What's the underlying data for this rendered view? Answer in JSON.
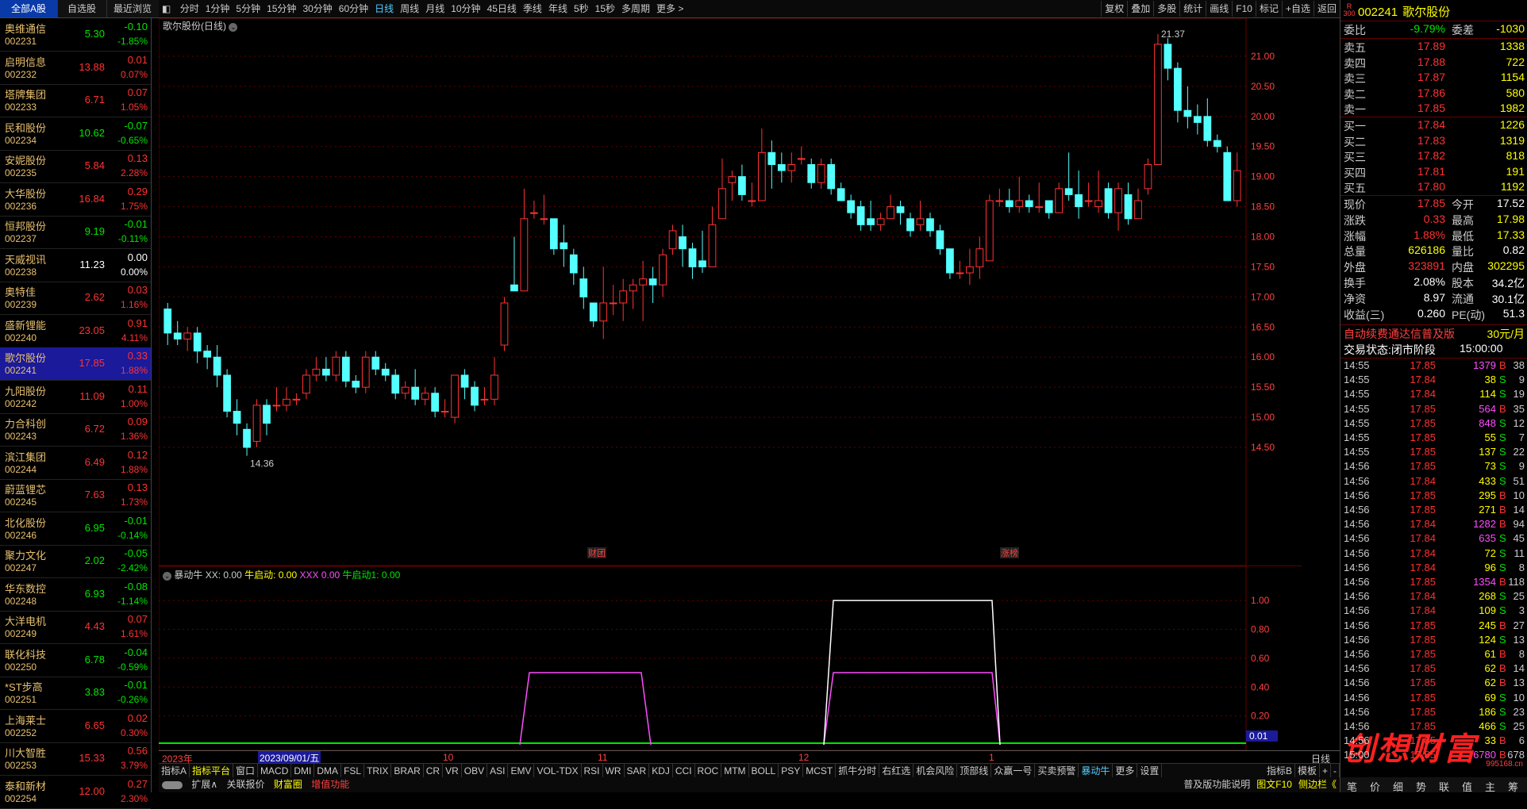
{
  "left_tabs": [
    "全部A股",
    "自选股",
    "最近浏览"
  ],
  "period_tabs": [
    "分时",
    "1分钟",
    "5分钟",
    "15分钟",
    "30分钟",
    "60分钟",
    "日线",
    "周线",
    "月线",
    "10分钟",
    "45日线",
    "季线",
    "年线",
    "5秒",
    "15秒",
    "多周期",
    "更多 >"
  ],
  "active_period": "日线",
  "tools": [
    "复权",
    "叠加",
    "多股",
    "统计",
    "画线",
    "F10",
    "标记",
    "+自选",
    "返回"
  ],
  "stocks": [
    {
      "name": "奥维通信",
      "code": "002231",
      "price": "5.30",
      "chg": "-0.10",
      "pct": "-1.85%",
      "dir": "dn"
    },
    {
      "name": "启明信息",
      "code": "002232",
      "price": "13.88",
      "chg": "0.01",
      "pct": "0.07%",
      "dir": "up"
    },
    {
      "name": "塔牌集团",
      "code": "002233",
      "price": "6.71",
      "chg": "0.07",
      "pct": "1.05%",
      "dir": "up"
    },
    {
      "name": "民和股份",
      "code": "002234",
      "price": "10.62",
      "chg": "-0.07",
      "pct": "-0.65%",
      "dir": "dn"
    },
    {
      "name": "安妮股份",
      "code": "002235",
      "price": "5.84",
      "chg": "0.13",
      "pct": "2.28%",
      "dir": "up"
    },
    {
      "name": "大华股份",
      "code": "002236",
      "price": "16.84",
      "chg": "0.29",
      "pct": "1.75%",
      "dir": "up"
    },
    {
      "name": "恒邦股份",
      "code": "002237",
      "price": "9.19",
      "chg": "-0.01",
      "pct": "-0.11%",
      "dir": "dn"
    },
    {
      "name": "天威视讯",
      "code": "002238",
      "price": "11.23",
      "chg": "0.00",
      "pct": "0.00%",
      "dir": "wh"
    },
    {
      "name": "奥特佳",
      "code": "002239",
      "price": "2.62",
      "chg": "0.03",
      "pct": "1.16%",
      "dir": "up"
    },
    {
      "name": "盛新锂能",
      "code": "002240",
      "price": "23.05",
      "chg": "0.91",
      "pct": "4.11%",
      "dir": "up"
    },
    {
      "name": "歌尔股份",
      "code": "002241",
      "price": "17.85",
      "chg": "0.33",
      "pct": "1.88%",
      "dir": "up"
    },
    {
      "name": "九阳股份",
      "code": "002242",
      "price": "11.09",
      "chg": "0.11",
      "pct": "1.00%",
      "dir": "up"
    },
    {
      "name": "力合科创",
      "code": "002243",
      "price": "6.72",
      "chg": "0.09",
      "pct": "1.36%",
      "dir": "up"
    },
    {
      "name": "滨江集团",
      "code": "002244",
      "price": "6.49",
      "chg": "0.12",
      "pct": "1.88%",
      "dir": "up"
    },
    {
      "name": "蔚蓝锂芯",
      "code": "002245",
      "price": "7.63",
      "chg": "0.13",
      "pct": "1.73%",
      "dir": "up"
    },
    {
      "name": "北化股份",
      "code": "002246",
      "price": "6.95",
      "chg": "-0.01",
      "pct": "-0.14%",
      "dir": "dn"
    },
    {
      "name": "聚力文化",
      "code": "002247",
      "price": "2.02",
      "chg": "-0.05",
      "pct": "-2.42%",
      "dir": "dn"
    },
    {
      "name": "华东数控",
      "code": "002248",
      "price": "6.93",
      "chg": "-0.08",
      "pct": "-1.14%",
      "dir": "dn"
    },
    {
      "name": "大洋电机",
      "code": "002249",
      "price": "4.43",
      "chg": "0.07",
      "pct": "1.61%",
      "dir": "up"
    },
    {
      "name": "联化科技",
      "code": "002250",
      "price": "6.78",
      "chg": "-0.04",
      "pct": "-0.59%",
      "dir": "dn"
    },
    {
      "name": "*ST步高",
      "code": "002251",
      "price": "3.83",
      "chg": "-0.01",
      "pct": "-0.26%",
      "dir": "dn"
    },
    {
      "name": "上海莱士",
      "code": "002252",
      "price": "6.65",
      "chg": "0.02",
      "pct": "0.30%",
      "dir": "up"
    },
    {
      "name": "川大智胜",
      "code": "002253",
      "price": "15.33",
      "chg": "0.56",
      "pct": "3.79%",
      "dir": "up"
    },
    {
      "name": "泰和新材",
      "code": "002254",
      "price": "12.00",
      "chg": "0.27",
      "pct": "2.30%",
      "dir": "up"
    }
  ],
  "selected_code": "002241",
  "chart": {
    "title": "歌尔股份(日线)",
    "high_label": "21.37",
    "low_label": "14.36",
    "price_ticks": [
      "21.00",
      "20.50",
      "20.00",
      "19.50",
      "19.00",
      "18.50",
      "18.00",
      "17.50",
      "17.00",
      "16.50",
      "16.00",
      "15.50",
      "15.00",
      "14.50"
    ],
    "markers": [
      "财团",
      "涨榜"
    ],
    "candles": [
      [
        16.8,
        16.4,
        16.9,
        16.2
      ],
      [
        16.4,
        16.3,
        16.6,
        16.2
      ],
      [
        16.3,
        16.4,
        16.5,
        16.1
      ],
      [
        16.4,
        16.1,
        16.5,
        15.9
      ],
      [
        16.1,
        16.0,
        16.2,
        15.8
      ],
      [
        16.0,
        15.7,
        16.2,
        15.5
      ],
      [
        15.7,
        15.1,
        15.8,
        15.0
      ],
      [
        15.1,
        14.9,
        15.3,
        14.7
      ],
      [
        14.8,
        14.5,
        14.9,
        14.36
      ],
      [
        14.6,
        15.2,
        15.3,
        14.5
      ],
      [
        15.2,
        14.9,
        15.3,
        14.7
      ],
      [
        15.2,
        15.2,
        15.5,
        15.1
      ],
      [
        15.2,
        15.3,
        15.5,
        15.1
      ],
      [
        15.3,
        15.3,
        15.4,
        15.2
      ],
      [
        15.4,
        15.7,
        15.8,
        15.3
      ],
      [
        15.7,
        15.8,
        16.0,
        15.6
      ],
      [
        15.8,
        15.7,
        16.0,
        15.6
      ],
      [
        15.7,
        16.0,
        16.1,
        15.6
      ],
      [
        16.0,
        15.6,
        16.1,
        15.5
      ],
      [
        15.6,
        15.5,
        15.7,
        15.4
      ],
      [
        15.5,
        16.0,
        16.1,
        15.4
      ],
      [
        16.0,
        15.8,
        16.1,
        15.7
      ],
      [
        15.8,
        15.7,
        15.9,
        15.6
      ],
      [
        15.7,
        15.4,
        15.8,
        15.3
      ],
      [
        15.4,
        15.5,
        15.6,
        15.3
      ],
      [
        15.5,
        15.3,
        15.8,
        15.2
      ],
      [
        15.3,
        15.4,
        15.5,
        15.2
      ],
      [
        15.4,
        15.1,
        15.5,
        15.0
      ],
      [
        15.1,
        15.1,
        15.3,
        15.0
      ],
      [
        15.0,
        15.7,
        15.7,
        14.9
      ],
      [
        15.7,
        15.5,
        15.8,
        15.3
      ],
      [
        15.5,
        15.2,
        15.6,
        15.1
      ],
      [
        15.3,
        15.3,
        15.5,
        15.2
      ],
      [
        15.3,
        15.7,
        16.0,
        15.2
      ],
      [
        16.2,
        16.9,
        17.0,
        16.1
      ],
      [
        17.2,
        17.1,
        18.0,
        17.1
      ],
      [
        17.1,
        18.3,
        18.8,
        17.1
      ],
      [
        18.4,
        18.4,
        18.6,
        18.3
      ],
      [
        18.3,
        18.3,
        18.7,
        18.2
      ],
      [
        18.3,
        17.8,
        18.3,
        17.7
      ],
      [
        17.9,
        17.8,
        18.2,
        17.5
      ],
      [
        17.7,
        17.4,
        17.8,
        17.2
      ],
      [
        17.3,
        17.0,
        17.5,
        16.8
      ],
      [
        16.9,
        16.6,
        16.9,
        16.5
      ],
      [
        16.6,
        16.9,
        17.5,
        16.3
      ],
      [
        16.9,
        16.9,
        17.2,
        16.7
      ],
      [
        16.9,
        17.1,
        17.3,
        16.6
      ],
      [
        17.1,
        17.2,
        17.3,
        16.8
      ],
      [
        17.2,
        17.3,
        17.6,
        16.6
      ],
      [
        17.3,
        17.2,
        17.5,
        16.9
      ],
      [
        17.2,
        17.7,
        17.8,
        17.0
      ],
      [
        17.8,
        18.1,
        18.2,
        17.7
      ],
      [
        18.0,
        17.8,
        18.2,
        17.5
      ],
      [
        17.8,
        17.5,
        17.9,
        17.3
      ],
      [
        17.6,
        17.5,
        18.1,
        17.4
      ],
      [
        17.5,
        18.2,
        18.5,
        17.5
      ],
      [
        18.3,
        18.8,
        19.3,
        18.3
      ],
      [
        18.9,
        19.0,
        19.1,
        18.6
      ],
      [
        19.0,
        18.7,
        19.2,
        18.6
      ],
      [
        18.6,
        18.6,
        18.9,
        18.5
      ],
      [
        18.6,
        19.4,
        19.8,
        18.6
      ],
      [
        19.4,
        19.2,
        19.6,
        18.8
      ],
      [
        19.2,
        19.1,
        19.4,
        18.9
      ],
      [
        19.1,
        19.2,
        19.4,
        18.9
      ],
      [
        19.3,
        19.3,
        19.5,
        19.2
      ],
      [
        19.2,
        18.9,
        19.3,
        18.8
      ],
      [
        18.9,
        19.2,
        19.3,
        18.8
      ],
      [
        19.2,
        18.8,
        19.3,
        18.7
      ],
      [
        18.8,
        18.6,
        18.9,
        18.6
      ],
      [
        18.6,
        18.4,
        18.7,
        18.3
      ],
      [
        18.5,
        18.2,
        18.6,
        18.1
      ],
      [
        18.3,
        18.2,
        18.6,
        18.1
      ],
      [
        18.2,
        18.3,
        18.4,
        18.1
      ],
      [
        18.3,
        18.5,
        18.7,
        18.3
      ],
      [
        18.5,
        18.4,
        18.6,
        18.2
      ],
      [
        18.3,
        18.1,
        18.4,
        18.0
      ],
      [
        18.2,
        18.3,
        18.6,
        18.1
      ],
      [
        18.3,
        18.1,
        18.4,
        18.0
      ],
      [
        18.1,
        17.8,
        18.2,
        17.7
      ],
      [
        17.8,
        17.4,
        17.8,
        17.3
      ],
      [
        17.4,
        17.4,
        17.6,
        17.3
      ],
      [
        17.4,
        17.5,
        17.8,
        17.2
      ],
      [
        17.5,
        17.8,
        18.0,
        17.3
      ],
      [
        17.6,
        18.6,
        18.7,
        17.6
      ],
      [
        18.6,
        18.6,
        18.8,
        18.5
      ],
      [
        18.6,
        18.5,
        18.8,
        18.4
      ],
      [
        18.5,
        18.6,
        19.0,
        18.4
      ],
      [
        18.6,
        18.5,
        18.7,
        18.4
      ],
      [
        18.5,
        18.5,
        18.9,
        18.4
      ],
      [
        18.6,
        18.4,
        18.6,
        18.3
      ],
      [
        18.4,
        18.8,
        18.9,
        18.4
      ],
      [
        18.8,
        18.7,
        19.4,
        18.6
      ],
      [
        18.7,
        18.5,
        19.1,
        18.3
      ],
      [
        18.6,
        18.6,
        18.9,
        18.5
      ],
      [
        18.5,
        18.6,
        19.1,
        18.4
      ],
      [
        18.8,
        18.4,
        18.9,
        18.3
      ],
      [
        18.4,
        18.8,
        18.9,
        18.1
      ],
      [
        18.7,
        18.3,
        18.9,
        18.2
      ],
      [
        18.3,
        18.6,
        18.8,
        18.3
      ],
      [
        18.8,
        19.2,
        19.3,
        18.7
      ],
      [
        19.2,
        21.2,
        21.37,
        19.2
      ],
      [
        21.2,
        20.8,
        21.3,
        20.6
      ],
      [
        20.8,
        20.1,
        20.9,
        19.9
      ],
      [
        20.1,
        20.0,
        20.5,
        19.8
      ],
      [
        20.0,
        19.9,
        20.2,
        19.7
      ],
      [
        20.0,
        19.6,
        20.3,
        19.5
      ],
      [
        19.6,
        19.5,
        19.7,
        19.4
      ],
      [
        19.4,
        18.6,
        19.5,
        18.6
      ],
      [
        18.6,
        19.1,
        19.4,
        18.5
      ]
    ]
  },
  "indicator": {
    "name": "暴动牛",
    "xx_label": "XX:",
    "xx_value": "0.00",
    "nqd_label": "牛启动:",
    "nqd_value": "0.00",
    "xxx_label": "XXX",
    "xxx_value": "0.00",
    "nqd1_label": "牛启动1:",
    "nqd1_value": "0.00",
    "ticks": [
      "1.00",
      "0.80",
      "0.60",
      "0.40",
      "0.20"
    ],
    "current_value": "0.01"
  },
  "date_axis": {
    "start": "2023年",
    "crosshair": "2023/09/01/五",
    "months": [
      "9",
      "10",
      "11",
      "12",
      "1"
    ],
    "right_label": "日线"
  },
  "indicator_tabs": [
    "指标A",
    "指标平台",
    "窗口",
    "MACD",
    "DMI",
    "DMA",
    "FSL",
    "TRIX",
    "BRAR",
    "CR",
    "VR",
    "OBV",
    "ASI",
    "EMV",
    "VOL-TDX",
    "RSI",
    "WR",
    "SAR",
    "KDJ",
    "CCI",
    "ROC",
    "MTM",
    "BOLL",
    "PSY",
    "MCST",
    "抓牛分时",
    "右红选",
    "机会风险",
    "顶部线",
    "众赢一号",
    "买卖预警",
    "暴动牛",
    "更多",
    "设置"
  ],
  "indicator_tabs_right": [
    "指标B",
    "模板"
  ],
  "bottom_tabs": [
    "扩展∧",
    "关联报价",
    "财富圈",
    "增值功能"
  ],
  "bottom_right": [
    "普及版功能说明",
    "图文F10",
    "侧边栏《"
  ],
  "quote": {
    "code": "002241",
    "name": "歌尔股份",
    "badge": "R300",
    "webi_label": "委比",
    "webi": "-9.79%",
    "wecha_label": "委差",
    "wecha": "-1030",
    "asks": [
      [
        "卖五",
        "17.89",
        "1338"
      ],
      [
        "卖四",
        "17.88",
        "722"
      ],
      [
        "卖三",
        "17.87",
        "1154"
      ],
      [
        "卖二",
        "17.86",
        "580"
      ],
      [
        "卖一",
        "17.85",
        "1982"
      ]
    ],
    "bids": [
      [
        "买一",
        "17.84",
        "1226"
      ],
      [
        "买二",
        "17.83",
        "1319"
      ],
      [
        "买三",
        "17.82",
        "818"
      ],
      [
        "买四",
        "17.81",
        "191"
      ],
      [
        "买五",
        "17.80",
        "1192"
      ]
    ],
    "stats": [
      [
        "现价",
        "17.85",
        "今开",
        "17.52"
      ],
      [
        "涨跌",
        "0.33",
        "最高",
        "17.98"
      ],
      [
        "涨幅",
        "1.88%",
        "最低",
        "17.33"
      ],
      [
        "总量",
        "626186",
        "量比",
        "0.82"
      ],
      [
        "外盘",
        "323891",
        "内盘",
        "302295"
      ],
      [
        "换手",
        "2.08%",
        "股本",
        "34.2亿"
      ],
      [
        "净资",
        "8.97",
        "流通",
        "30.1亿"
      ],
      [
        "收益(三)",
        "0.260",
        "PE(动)",
        "51.3"
      ]
    ],
    "ad": "自动续费通达信普及版",
    "ad_price": "30元/月",
    "trade_status": "交易状态:闭市阶段",
    "trade_time": "15:00:00",
    "ticks": [
      [
        "14:55",
        "17.85",
        "1379",
        "B",
        "38",
        "mg"
      ],
      [
        "14:55",
        "17.84",
        "38",
        "S",
        "9",
        "yl"
      ],
      [
        "14:55",
        "17.84",
        "114",
        "S",
        "19",
        "yl"
      ],
      [
        "14:55",
        "17.85",
        "564",
        "B",
        "35",
        "mg"
      ],
      [
        "14:55",
        "17.85",
        "848",
        "S",
        "12",
        "mg"
      ],
      [
        "14:55",
        "17.85",
        "55",
        "S",
        "7",
        "yl"
      ],
      [
        "14:55",
        "17.85",
        "137",
        "S",
        "22",
        "yl"
      ],
      [
        "14:56",
        "17.85",
        "73",
        "S",
        "9",
        "yl"
      ],
      [
        "14:56",
        "17.84",
        "433",
        "S",
        "51",
        "yl"
      ],
      [
        "14:56",
        "17.85",
        "295",
        "B",
        "10",
        "yl"
      ],
      [
        "14:56",
        "17.85",
        "271",
        "B",
        "14",
        "yl"
      ],
      [
        "14:56",
        "17.84",
        "1282",
        "B",
        "94",
        "mg"
      ],
      [
        "14:56",
        "17.84",
        "635",
        "S",
        "45",
        "mg"
      ],
      [
        "14:56",
        "17.84",
        "72",
        "S",
        "11",
        "yl"
      ],
      [
        "14:56",
        "17.84",
        "96",
        "S",
        "8",
        "yl"
      ],
      [
        "14:56",
        "17.85",
        "1354",
        "B",
        "118",
        "mg"
      ],
      [
        "14:56",
        "17.84",
        "268",
        "S",
        "25",
        "yl"
      ],
      [
        "14:56",
        "17.84",
        "109",
        "S",
        "3",
        "yl"
      ],
      [
        "14:56",
        "17.85",
        "245",
        "B",
        "27",
        "yl"
      ],
      [
        "14:56",
        "17.85",
        "124",
        "S",
        "13",
        "yl"
      ],
      [
        "14:56",
        "17.85",
        "61",
        "B",
        "8",
        "yl"
      ],
      [
        "14:56",
        "17.85",
        "62",
        "B",
        "14",
        "yl"
      ],
      [
        "14:56",
        "17.85",
        "62",
        "B",
        "13",
        "yl"
      ],
      [
        "14:56",
        "17.85",
        "69",
        "S",
        "10",
        "yl"
      ],
      [
        "14:56",
        "17.85",
        "186",
        "S",
        "23",
        "yl"
      ],
      [
        "14:56",
        "17.85",
        "466",
        "S",
        "25",
        "yl"
      ],
      [
        "14:56",
        "17.85",
        "33",
        "B",
        "6",
        "yl"
      ],
      [
        "15:00",
        "17.85",
        "6780",
        "B",
        "678",
        "mg"
      ]
    ],
    "watermark": "创想财富",
    "watermark_url": "995168.cn",
    "footer_tabs": [
      "笔",
      "价",
      "细",
      "势",
      "联",
      "值",
      "主",
      "筹"
    ]
  }
}
